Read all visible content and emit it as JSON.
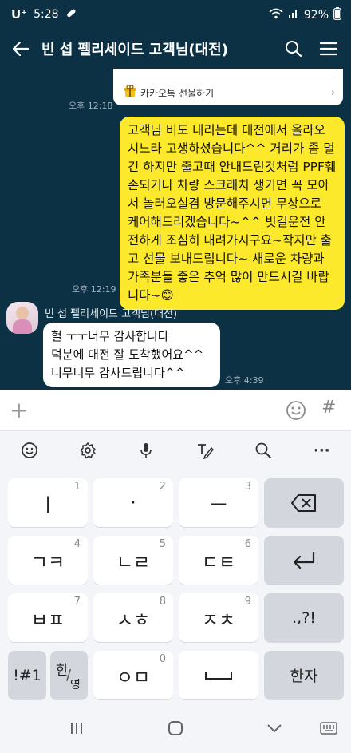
{
  "status_bar": {
    "carrier": "U⁺",
    "time": "5:28",
    "battery": "92%"
  },
  "header": {
    "title": "빈  섭 펠리세이드 고객님(대전)"
  },
  "chat": {
    "gift_card": {
      "label": "카카오톡 선물하기"
    },
    "messages": [
      {
        "sender": "me",
        "time": "오후 12:18"
      },
      {
        "sender": "me",
        "text": "고객님 비도 내리는데 대전에서 올라오시느라 고생하셨습니다^^ 거리가 좀 멀긴 하지만 출고때 안내드린것처럼 PPF훼손되거나 차량 스크래치 생기면 꼭 모아서 놀러오실겸 방문해주시면 무상으로 케어해드리겠습니다~^^ 빗길운전 안전하게 조심히 내려가시구요~작지만 출고 선물 보내드립니다~ 새로운 차량과 가족분들 좋은 추억 많이 만드시길 바랍니다~😊",
        "time": "오후 12:19"
      },
      {
        "sender": "other",
        "name": "빈  섭 펠리세이드 고객님(대전)",
        "lines": [
          "헐 ㅜㅜ너무 감사합니다",
          "덕분에 대전 잘 도착했어요^^",
          "너무너무 감사드립니다^^"
        ],
        "time": "오후 4:39"
      }
    ]
  },
  "input_bar": {
    "plus": "+",
    "hash": "#"
  },
  "keyboard": {
    "toolbar": [
      "emoji-icon",
      "settings-icon",
      "mic-icon",
      "handwriting-icon",
      "search-icon",
      "more-icon"
    ],
    "more_label": "···",
    "keys": [
      {
        "label": "ㅣ",
        "num": "1"
      },
      {
        "label": "·",
        "num": "2"
      },
      {
        "label": "ㅡ",
        "num": "3"
      },
      {
        "label": "ㄱㅋ",
        "num": "4"
      },
      {
        "label": "ㄴㄹ",
        "num": "5"
      },
      {
        "label": "ㄷㅌ",
        "num": "6"
      },
      {
        "label": "ㅂㅍ",
        "num": "7"
      },
      {
        "label": "ㅅㅎ",
        "num": "8"
      },
      {
        "label": "ㅈㅊ",
        "num": "9"
      },
      {
        "label": "ㅇㅁ",
        "num": "0"
      }
    ],
    "punct": ".,?!",
    "sym": "!#1",
    "lang_top": "한",
    "lang_bottom": "영",
    "hanja": "한자"
  },
  "colors": {
    "chat_bg": "#0d3144",
    "my_bubble": "#fde92c",
    "other_bubble": "#ffffff"
  }
}
